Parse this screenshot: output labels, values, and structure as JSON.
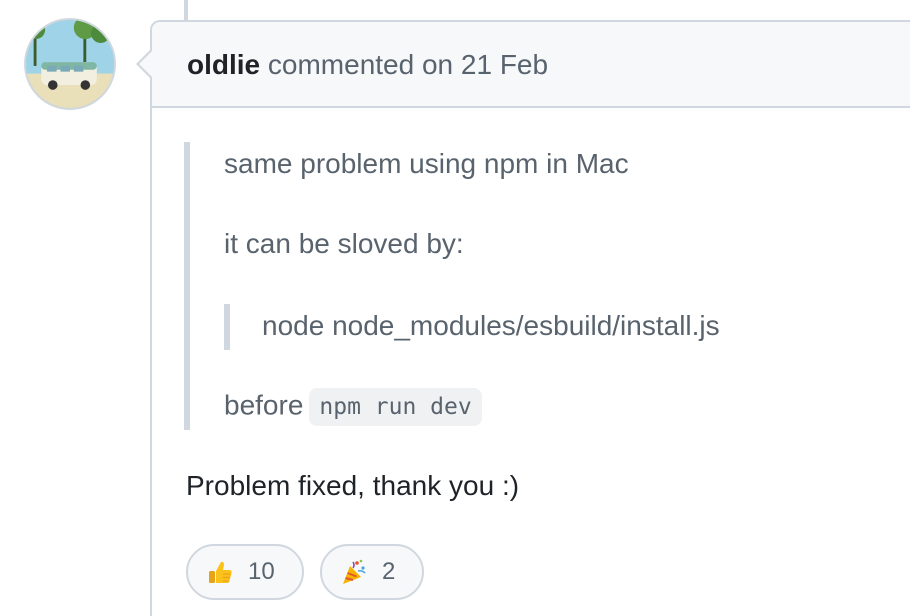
{
  "comment": {
    "author": "oldlie",
    "action": "commented on 21 Feb",
    "quote": {
      "line1": "same problem using npm in Mac",
      "line2": "it can be sloved by:",
      "nested_quote": "node node_modules/esbuild/install.js",
      "line3_prefix": "before",
      "line3_code": "npm run dev"
    },
    "body": "Problem fixed, thank you :)"
  },
  "reactions": [
    {
      "icon": "thumbs-up-icon",
      "count": "10"
    },
    {
      "icon": "party-popper-icon",
      "count": "2"
    }
  ]
}
